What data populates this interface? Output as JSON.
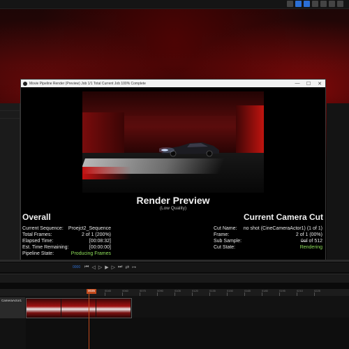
{
  "window": {
    "title": "Movie Pipeline Render (Preview) Job 1/1 Total Current Job 100% Complete",
    "controls": {
      "minimize": "—",
      "maximize": "☐",
      "close": "✕"
    }
  },
  "preview": {
    "heading": "Render Preview",
    "quality": "(Low Quality)"
  },
  "overall": {
    "title": "Overall",
    "rows": [
      {
        "label": "Current Sequence:",
        "value": "Proejct2_Sequence"
      },
      {
        "label": "Total Frames:",
        "value": "2 of 1 (200%)"
      },
      {
        "label": "Elapsed Time:",
        "value": "[00:08:32]"
      },
      {
        "label": "Est. Time Remaining:",
        "value": "[00:00:00]"
      },
      {
        "label": "Pipeline State:",
        "value": "Producing Frames"
      }
    ]
  },
  "camera_cut": {
    "title": "Current Camera Cut",
    "rows": [
      {
        "label": "Cut Name:",
        "value": "no shot (CineCameraActor1) (1 of 1)"
      },
      {
        "label": "Frame:",
        "value": "2 of 1 (00%)"
      },
      {
        "label": "Sub Sample:",
        "value_struck": "0of",
        "value": "of 512"
      },
      {
        "label": "Cut State:",
        "value": "Rendering"
      }
    ]
  },
  "sequencer": {
    "timecode": "0000",
    "playhead_label": "0035",
    "ruler_ticks": [
      "0035",
      "0045",
      "0060",
      "0075",
      "0090",
      "0105",
      "0120",
      "0135",
      "0150",
      "0165",
      "0180",
      "0195",
      "0210",
      "0225"
    ],
    "track_name": "CameraActor1",
    "transport": [
      "⏮",
      "◁",
      "▷",
      "▶",
      "▷",
      "⏭",
      "⇄",
      "↦"
    ]
  },
  "colors": {
    "state_green": "#8fe05a",
    "accent_blue": "#2b6fd6",
    "playhead": "#c24a1c"
  }
}
